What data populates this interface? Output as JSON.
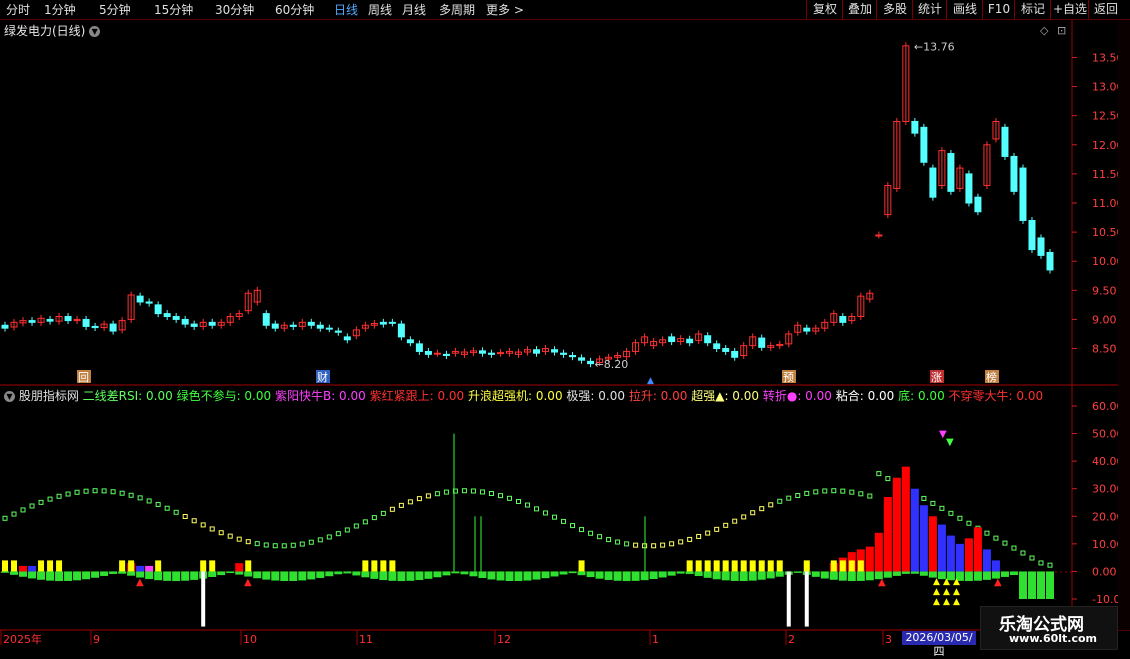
{
  "toolbar": {
    "periods": [
      "分时",
      "1分钟",
      "5分钟",
      "15分钟",
      "30分钟",
      "60分钟",
      "日线",
      "周线",
      "月线",
      "多周期",
      "更多"
    ],
    "active_period": "日线",
    "buttons": [
      "复权",
      "叠加",
      "多股",
      "统计",
      "画线",
      "F10",
      "标记",
      "+自选",
      "返回"
    ]
  },
  "stock": {
    "name": "绿发电力(日线)"
  },
  "price_axis": [
    "13.50",
    "13.00",
    "12.50",
    "12.00",
    "11.50",
    "11.00",
    "10.50",
    "10.00",
    "9.50",
    "9.00",
    "8.50"
  ],
  "price_markers": {
    "high": "13.76",
    "low": "8.20"
  },
  "event_tags": [
    "回",
    "财",
    "预",
    "涨",
    "榜"
  ],
  "indicator": {
    "name": "股朋指标网",
    "fields": [
      {
        "label": "二线差RSI: 0.00",
        "color": "#60ff60"
      },
      {
        "label": "绿色不参与: 0.00",
        "color": "#40ff40"
      },
      {
        "label": "紫阳快牛B: 0.00",
        "color": "#ff40ff"
      },
      {
        "label": "紫红紧跟上: 0.00",
        "color": "#ff3030"
      },
      {
        "label": "升浪超强机: 0.00",
        "color": "#ffff40"
      },
      {
        "label": "极强: 0.00",
        "color": "#e0e0e0"
      },
      {
        "label": "拉升: 0.00",
        "color": "#ff4040"
      },
      {
        "label": "超强▲: 0.00",
        "color": "#ffff80"
      },
      {
        "label": "转折●: 0.00",
        "color": "#ff40ff"
      },
      {
        "label": "粘合: 0.00",
        "color": "#ffffff"
      },
      {
        "label": "底: 0.00",
        "color": "#40ff40"
      },
      {
        "label": "不穿零大牛: 0.00",
        "color": "#ff3030"
      }
    ]
  },
  "indicator_axis": [
    "60.00",
    "50.00",
    "40.00",
    "30.00",
    "20.00",
    "10.00",
    "0.00",
    "-10.00"
  ],
  "time_axis": {
    "labels": [
      "2025年",
      "9",
      "10",
      "11",
      "12",
      "1",
      "2",
      "3"
    ],
    "selected_date": "2026/03/05/四"
  },
  "watermark": {
    "name": "乐淘公式网",
    "url": "www.60lt.com"
  },
  "colors": {
    "up": "#ff3030",
    "down": "#54ffff",
    "accent": "#3c8cff"
  },
  "chart_data": {
    "type": "candlestick",
    "title": "绿发电力(日线)",
    "price_ylim": [
      8.2,
      13.8
    ],
    "candles": [
      [
        8.9,
        8.85
      ],
      [
        8.87,
        8.95
      ],
      [
        8.94,
        8.98
      ],
      [
        8.98,
        8.95
      ],
      [
        8.95,
        9.02
      ],
      [
        9.0,
        8.97
      ],
      [
        8.97,
        9.05
      ],
      [
        9.05,
        8.98
      ],
      [
        8.98,
        9.0
      ],
      [
        9.0,
        8.88
      ],
      [
        8.88,
        8.86
      ],
      [
        8.86,
        8.92
      ],
      [
        8.92,
        8.8
      ],
      [
        8.82,
        8.98
      ],
      [
        9.0,
        9.42
      ],
      [
        9.4,
        9.3
      ],
      [
        9.3,
        9.28
      ],
      [
        9.25,
        9.1
      ],
      [
        9.1,
        9.05
      ],
      [
        9.05,
        9.0
      ],
      [
        9.0,
        8.92
      ],
      [
        8.92,
        8.88
      ],
      [
        8.88,
        8.95
      ],
      [
        8.95,
        8.9
      ],
      [
        8.9,
        8.95
      ],
      [
        8.95,
        9.05
      ],
      [
        9.05,
        9.1
      ],
      [
        9.15,
        9.45
      ],
      [
        9.3,
        9.5
      ],
      [
        9.1,
        8.9
      ],
      [
        8.92,
        8.85
      ],
      [
        8.85,
        8.9
      ],
      [
        8.9,
        8.88
      ],
      [
        8.88,
        8.95
      ],
      [
        8.95,
        8.9
      ],
      [
        8.9,
        8.85
      ],
      [
        8.85,
        8.84
      ],
      [
        8.8,
        8.78
      ],
      [
        8.7,
        8.65
      ],
      [
        8.72,
        8.82
      ],
      [
        8.85,
        8.9
      ],
      [
        8.9,
        8.93
      ],
      [
        8.95,
        8.92
      ],
      [
        8.95,
        8.94
      ],
      [
        8.92,
        8.7
      ],
      [
        8.65,
        8.6
      ],
      [
        8.58,
        8.45
      ],
      [
        8.45,
        8.4
      ],
      [
        8.42,
        8.42
      ],
      [
        8.4,
        8.38
      ],
      [
        8.42,
        8.45
      ],
      [
        8.4,
        8.44
      ],
      [
        8.43,
        8.46
      ],
      [
        8.46,
        8.42
      ],
      [
        8.42,
        8.4
      ],
      [
        8.42,
        8.43
      ],
      [
        8.42,
        8.45
      ],
      [
        8.4,
        8.44
      ],
      [
        8.44,
        8.48
      ],
      [
        8.48,
        8.42
      ],
      [
        8.45,
        8.5
      ],
      [
        8.48,
        8.44
      ],
      [
        8.42,
        8.4
      ],
      [
        8.38,
        8.36
      ],
      [
        8.34,
        8.3
      ],
      [
        8.28,
        8.24
      ],
      [
        8.26,
        8.32
      ],
      [
        8.32,
        8.35
      ],
      [
        8.35,
        8.38
      ],
      [
        8.36,
        8.45
      ],
      [
        8.45,
        8.6
      ],
      [
        8.6,
        8.7
      ],
      [
        8.55,
        8.62
      ],
      [
        8.6,
        8.65
      ],
      [
        8.7,
        8.62
      ],
      [
        8.62,
        8.67
      ],
      [
        8.66,
        8.6
      ],
      [
        8.64,
        8.75
      ],
      [
        8.72,
        8.6
      ],
      [
        8.58,
        8.5
      ],
      [
        8.5,
        8.45
      ],
      [
        8.45,
        8.35
      ],
      [
        8.38,
        8.55
      ],
      [
        8.55,
        8.7
      ],
      [
        8.68,
        8.52
      ],
      [
        8.52,
        8.55
      ],
      [
        8.55,
        8.57
      ],
      [
        8.58,
        8.75
      ],
      [
        8.78,
        8.9
      ],
      [
        8.85,
        8.8
      ],
      [
        8.8,
        8.85
      ],
      [
        8.85,
        8.95
      ],
      [
        8.95,
        9.1
      ],
      [
        9.05,
        8.95
      ],
      [
        8.98,
        9.05
      ],
      [
        9.05,
        9.4
      ],
      [
        9.35,
        9.45
      ],
      [
        10.45,
        10.45
      ],
      [
        10.8,
        11.3
      ],
      [
        11.25,
        12.4
      ],
      [
        12.4,
        13.7
      ],
      [
        12.4,
        12.2
      ],
      [
        12.3,
        11.7
      ],
      [
        11.6,
        11.1
      ],
      [
        11.3,
        11.9
      ],
      [
        11.85,
        11.2
      ],
      [
        11.25,
        11.6
      ],
      [
        11.5,
        11.0
      ],
      [
        11.1,
        10.85
      ],
      [
        11.3,
        12.0
      ],
      [
        12.1,
        12.4
      ],
      [
        12.3,
        11.8
      ],
      [
        11.8,
        11.2
      ],
      [
        11.6,
        10.7
      ],
      [
        10.7,
        10.2
      ],
      [
        10.4,
        10.1
      ],
      [
        10.15,
        9.85
      ]
    ]
  }
}
